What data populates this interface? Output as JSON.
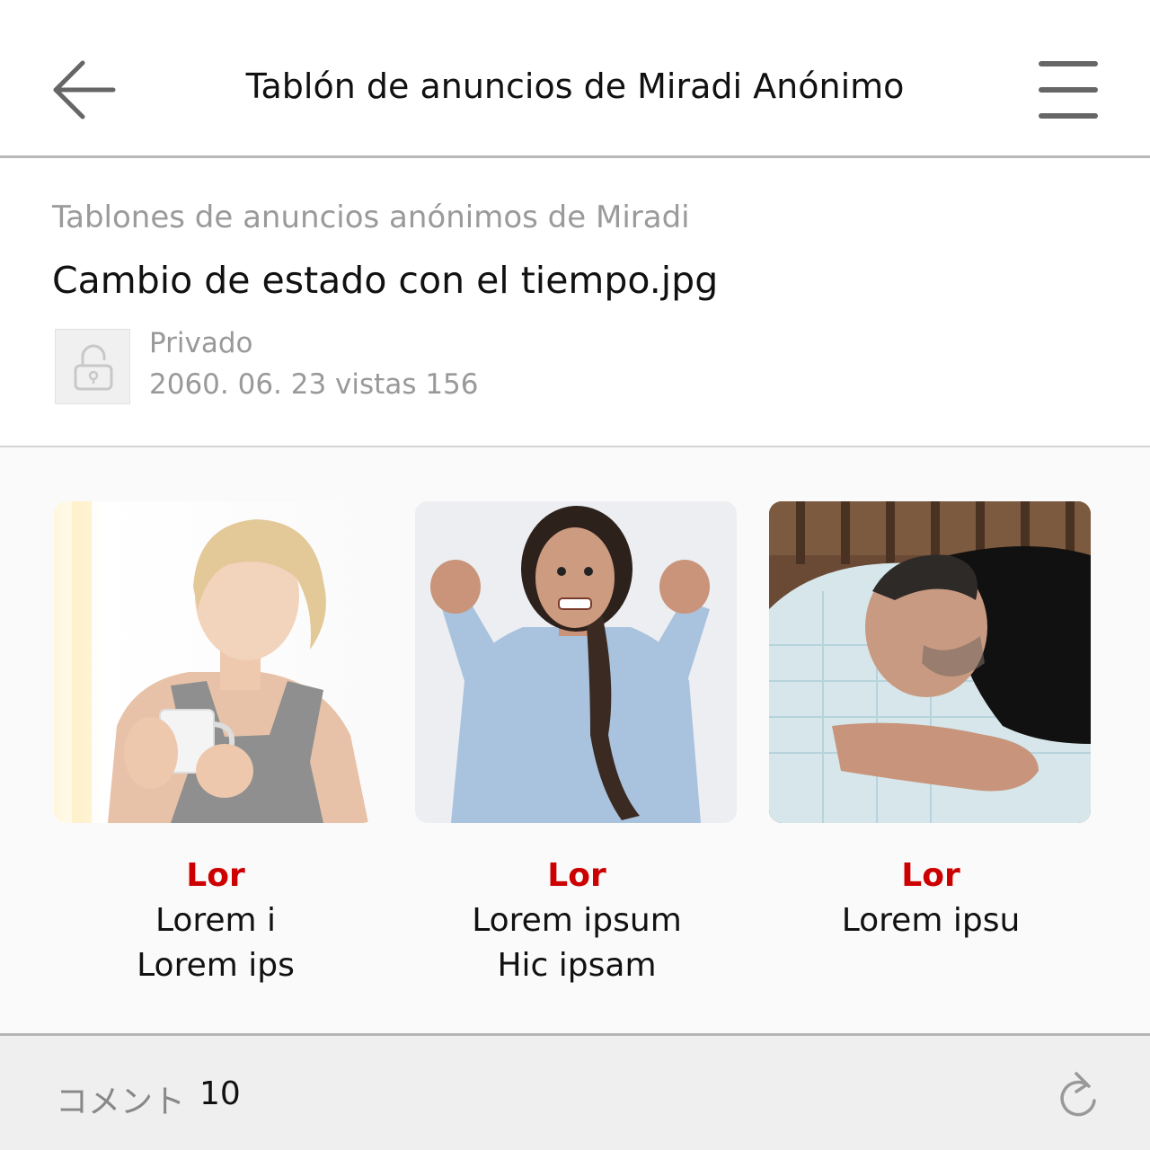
{
  "header": {
    "title": "Tablón de anuncios de Miradi Anónimo",
    "back_icon": "arrow-left-icon",
    "menu_icon": "hamburger-menu-icon"
  },
  "post": {
    "board": "Tablones de anuncios anónimos de Miradi",
    "title": "Cambio de estado con el tiempo.jpg",
    "author": "Privado",
    "date_views": "2060. 06. 23 vistas 156",
    "avatar_icon": "lock-icon"
  },
  "cards": [
    {
      "label": "Lor",
      "lines": [
        "Lorem i",
        "Lorem ips"
      ]
    },
    {
      "label": "Lor",
      "lines": [
        "Lorem ipsum",
        "Hic ipsam"
      ]
    },
    {
      "label": "Lor",
      "lines": [
        "Lorem ipsu",
        ""
      ]
    }
  ],
  "footer": {
    "comment_label": "コメント",
    "comment_count": "10",
    "refresh_icon": "refresh-icon"
  },
  "colors": {
    "accent_red": "#cc0000",
    "muted_text": "#999999",
    "footer_bg": "#efefef"
  }
}
